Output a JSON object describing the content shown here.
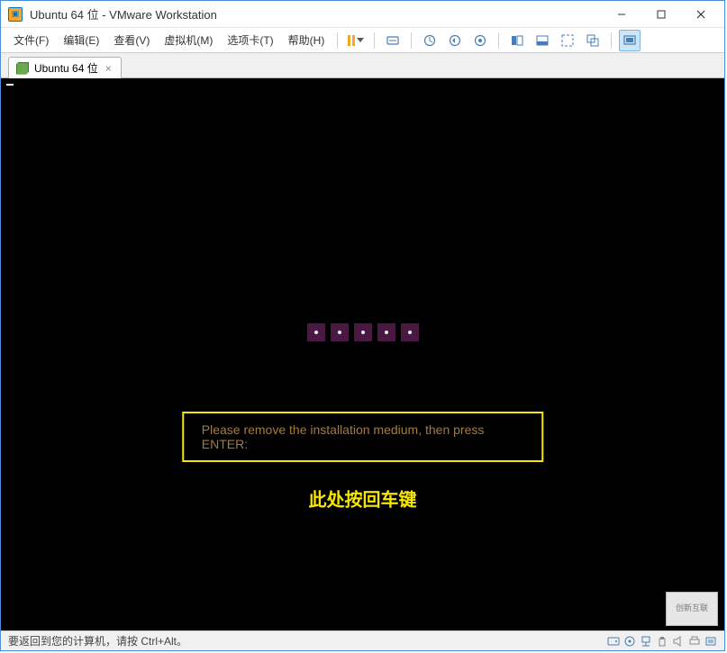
{
  "titlebar": {
    "title": "Ubuntu 64 位 - VMware Workstation"
  },
  "menu": {
    "file": "文件(F)",
    "edit": "编辑(E)",
    "view": "查看(V)",
    "vm": "虚拟机(M)",
    "tabs": "选项卡(T)",
    "help": "帮助(H)"
  },
  "toolbar_icons": {
    "pause": "pause",
    "power": "power-icon",
    "send_keys": "send-keys-icon",
    "snapshot": "snapshot-icon",
    "snapshot_revert": "snapshot-revert-icon",
    "snapshot_manager": "snapshot-manager-icon",
    "split1": "panel-icon",
    "split2": "thumbnail-icon",
    "fullscreen": "fullscreen-icon",
    "unity": "unity-icon",
    "console": "console-icon"
  },
  "tab": {
    "label": "Ubuntu 64 位"
  },
  "vm": {
    "install_msg": "Please remove the installation medium, then press ENTER:",
    "annotation": "此处按回车键"
  },
  "statusbar": {
    "hint": "要返回到您的计算机，请按 Ctrl+Alt。"
  },
  "watermark": "创新互联"
}
